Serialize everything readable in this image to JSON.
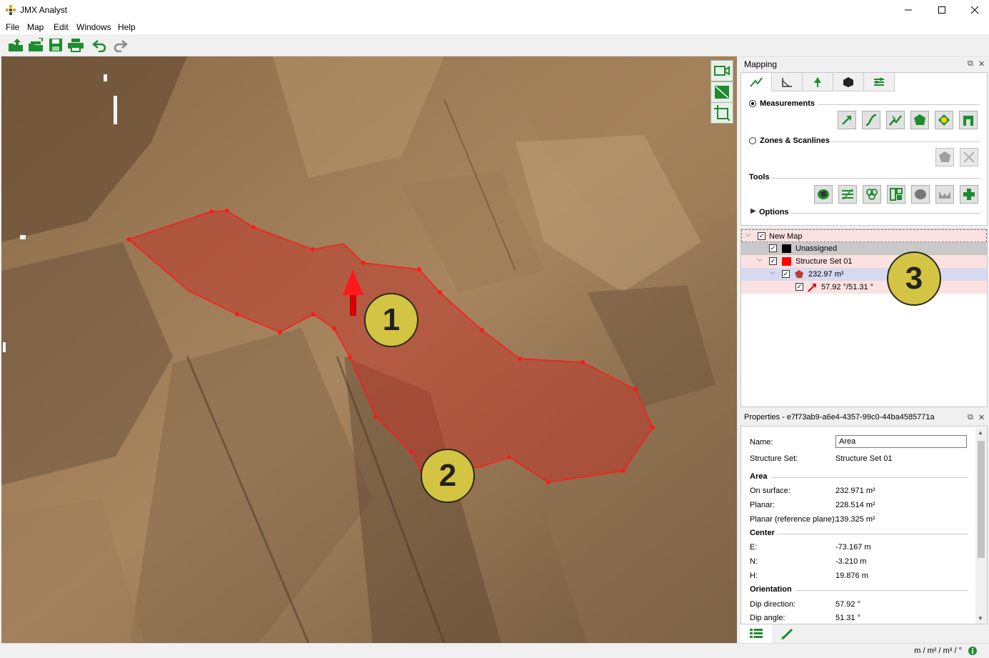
{
  "window": {
    "title": "JMX Analyst",
    "min_label": "—",
    "max_label": "☐",
    "close_label": "✕"
  },
  "menu": [
    {
      "label": "File"
    },
    {
      "label": "Map"
    },
    {
      "label": "Edit"
    },
    {
      "label": "Windows"
    },
    {
      "label": "Help"
    }
  ],
  "toolbar_icons": [
    "open-folder-icon",
    "open-project-icon",
    "save-icon",
    "print-icon",
    "undo-icon",
    "redo-icon"
  ],
  "viewport_tools": [
    "camera-icon",
    "plane-icon",
    "frame-icon"
  ],
  "callouts": [
    "1",
    "2",
    "3"
  ],
  "mapping": {
    "title": "Mapping",
    "measurements_label": "Measurements",
    "zones_label": "Zones & Scanlines",
    "tools_label": "Tools",
    "options_label": "Options"
  },
  "tree": {
    "root": "New Map",
    "unassigned": "Unassigned",
    "structure_set": "Structure Set 01",
    "area_item": "232.97 m²",
    "orientation_item": "57.92 °/51.31 °"
  },
  "properties": {
    "title": "Properties - e7f73ab9-a6e4-4357-99c0-44ba4585771a",
    "name_label": "Name:",
    "name_value": "Area",
    "structure_set_label": "Structure Set:",
    "structure_set_value": "Structure Set 01",
    "area_section": "Area",
    "on_surface_label": "On surface:",
    "on_surface_value": "232.971 m²",
    "planar_label": "Planar:",
    "planar_value": "228.514 m²",
    "planar_ref_label": "Planar (reference plane):",
    "planar_ref_value": "139.325 m²",
    "center_section": "Center",
    "e_label": "E:",
    "e_value": "-73.167 m",
    "n_label": "N:",
    "n_value": "-3.210 m",
    "h_label": "H:",
    "h_value": "19.876 m",
    "orientation_section": "Orientation",
    "dip_direction_label": "Dip direction:",
    "dip_direction_value": "57.92 °",
    "dip_angle_label": "Dip angle:",
    "dip_angle_value": "51.31 °"
  },
  "status": {
    "units": "m / m² / m³ / °"
  },
  "colors": {
    "polygon_fill": "#c0392b",
    "polygon_stroke": "#ff1a1a",
    "icon_green": "#1e8c2e",
    "callout": "#d4c443",
    "structure_set_red": "#ff0000"
  }
}
